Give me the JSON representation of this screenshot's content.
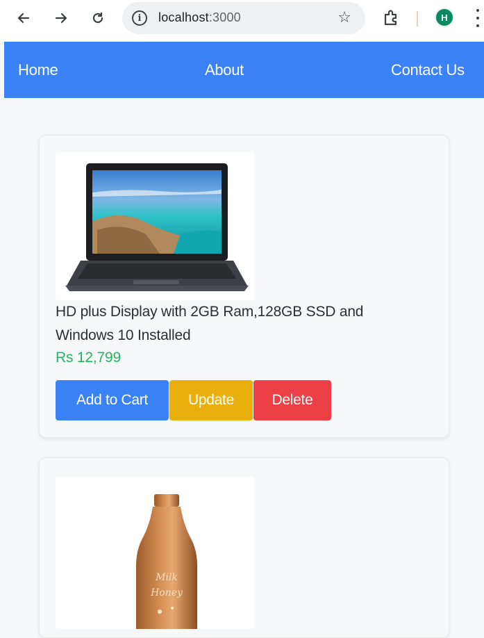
{
  "browser": {
    "url_host": "localhost",
    "url_port": ":3000",
    "profile_initial": "H",
    "icons": [
      "back-arrow-icon",
      "forward-arrow-icon",
      "reload-icon",
      "site-info-icon",
      "bookmark-star-icon",
      "extensions-icon",
      "menu-kebab-icon"
    ]
  },
  "navbar": {
    "home": "Home",
    "about": "About",
    "contact": "Contact Us",
    "color": "#3b82f6"
  },
  "products": [
    {
      "title": "HD plus Display with 2GB Ram,128GB SSD and Windows 10 Installed",
      "price": "Rs 12,799",
      "add_to_cart": "Add to Cart",
      "update": "Update",
      "delete": "Delete",
      "image": "laptop-image"
    },
    {
      "image": "bottle-image"
    }
  ],
  "colors": {
    "price": "#22b55c",
    "add_button": "#3b82f6",
    "update_button": "#e9b00d",
    "delete_button": "#ec4046"
  }
}
